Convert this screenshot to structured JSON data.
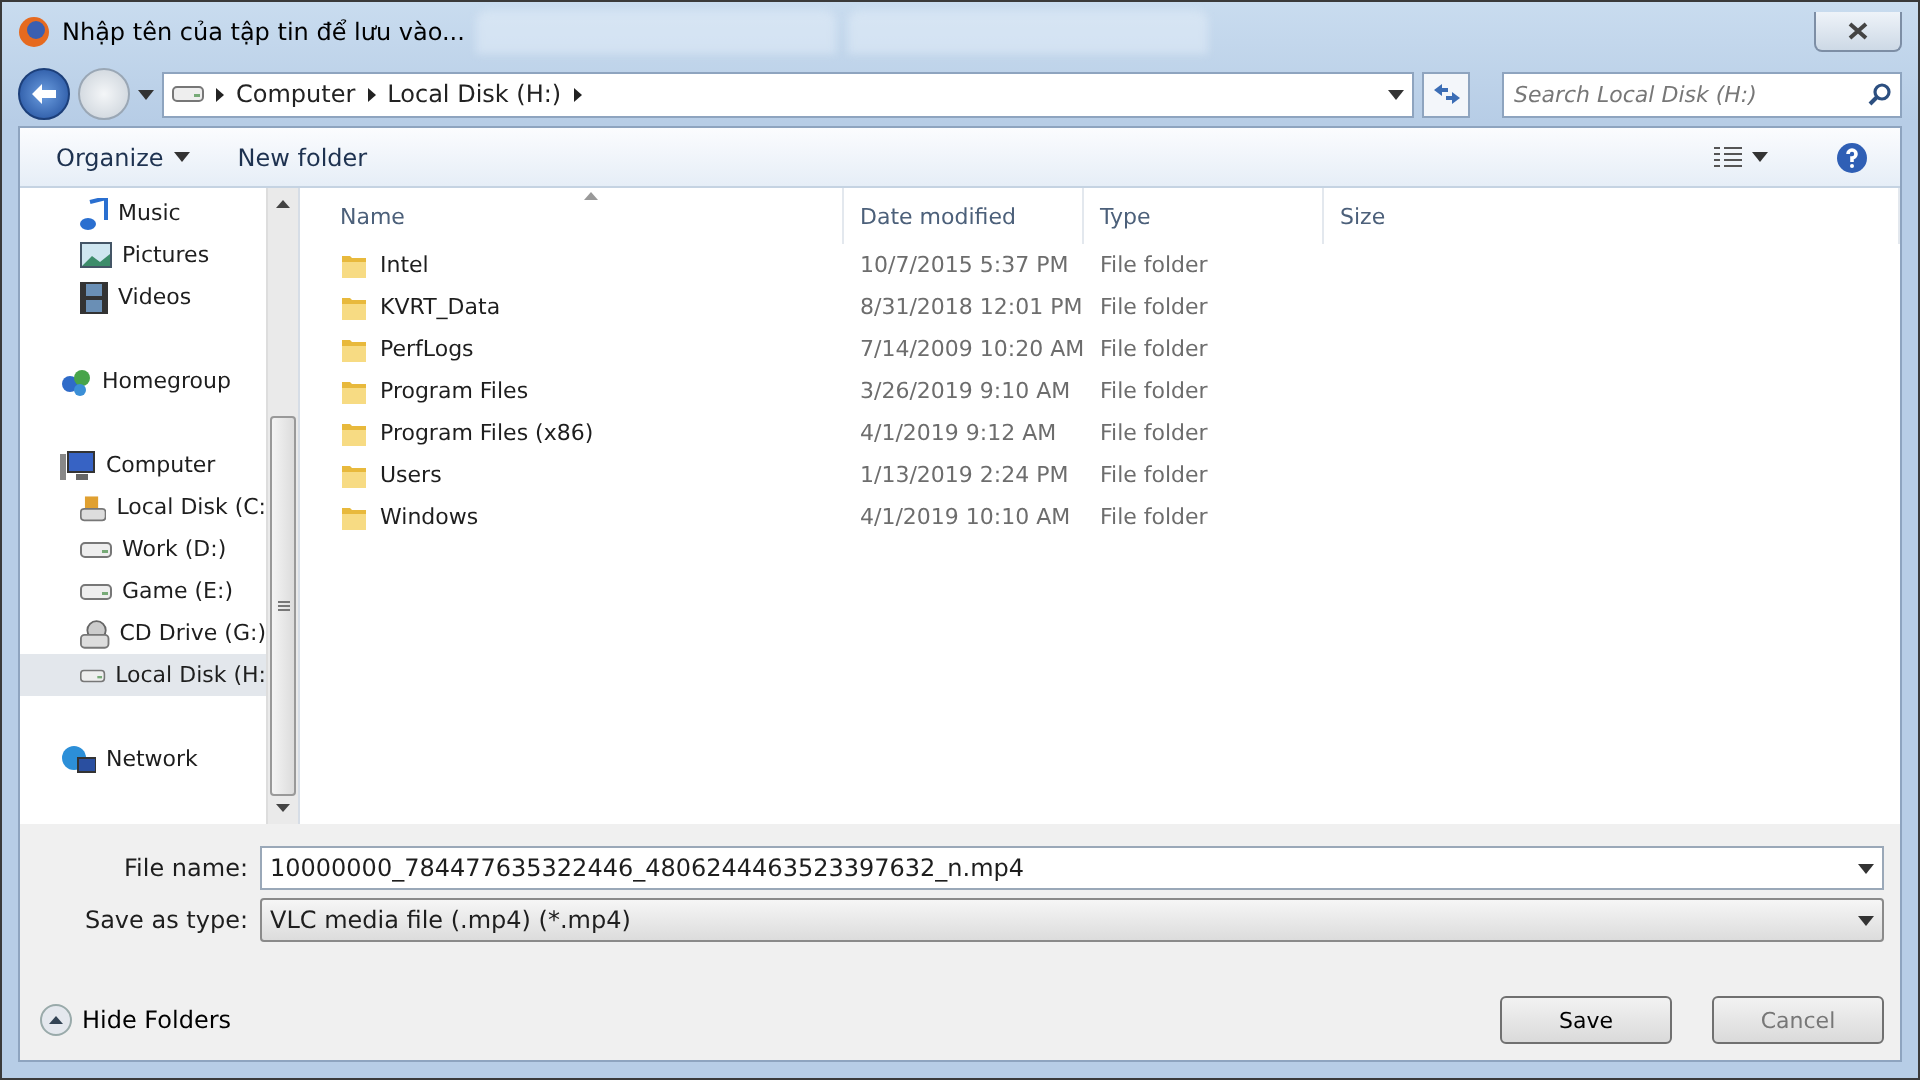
{
  "window": {
    "title": "Nhập tên của tập tin để lưu vào..."
  },
  "address": {
    "crumbs": [
      "Computer",
      "Local Disk (H:)"
    ],
    "search_placeholder": "Search Local Disk (H:)"
  },
  "toolbar": {
    "organize": "Organize",
    "new_folder": "New folder"
  },
  "sidebar": {
    "sections": [
      {
        "items": [
          {
            "label": "Music",
            "kind": "music",
            "selected": false
          },
          {
            "label": "Pictures",
            "kind": "pictures",
            "selected": false
          },
          {
            "label": "Videos",
            "kind": "videos",
            "selected": false
          }
        ]
      },
      {
        "items": [
          {
            "label": "Homegroup",
            "kind": "homegroup",
            "selected": false
          }
        ]
      },
      {
        "items": [
          {
            "label": "Computer",
            "kind": "computer",
            "selected": false,
            "children": [
              {
                "label": "Local Disk (C:",
                "kind": "system",
                "selected": false
              },
              {
                "label": "Work (D:)",
                "kind": "drive",
                "selected": false
              },
              {
                "label": "Game (E:)",
                "kind": "drive",
                "selected": false
              },
              {
                "label": "CD Drive (G:)",
                "kind": "cd",
                "selected": false
              },
              {
                "label": "Local Disk (H:",
                "kind": "drive",
                "selected": true
              }
            ]
          }
        ]
      },
      {
        "items": [
          {
            "label": "Network",
            "kind": "network",
            "selected": false
          }
        ]
      }
    ]
  },
  "table": {
    "columns": [
      "Name",
      "Date modified",
      "Type",
      "Size"
    ],
    "rows": [
      {
        "name": "Intel",
        "date": "10/7/2015 5:37 PM",
        "type": "File folder"
      },
      {
        "name": "KVRT_Data",
        "date": "8/31/2018 12:01 PM",
        "type": "File folder"
      },
      {
        "name": "PerfLogs",
        "date": "7/14/2009 10:20 AM",
        "type": "File folder"
      },
      {
        "name": "Program Files",
        "date": "3/26/2019 9:10 AM",
        "type": "File folder"
      },
      {
        "name": "Program Files (x86)",
        "date": "4/1/2019 9:12 AM",
        "type": "File folder"
      },
      {
        "name": "Users",
        "date": "1/13/2019 2:24 PM",
        "type": "File folder"
      },
      {
        "name": "Windows",
        "date": "4/1/2019 10:10 AM",
        "type": "File folder"
      }
    ]
  },
  "form": {
    "file_name_label": "File name:",
    "file_name": "10000000_784477635322446_4806244463523397632_n.mp4",
    "type_label": "Save as type:",
    "type": "VLC media file (.mp4) (*.mp4)"
  },
  "footer": {
    "hide_folders": "Hide Folders",
    "save": "Save",
    "cancel": "Cancel"
  }
}
